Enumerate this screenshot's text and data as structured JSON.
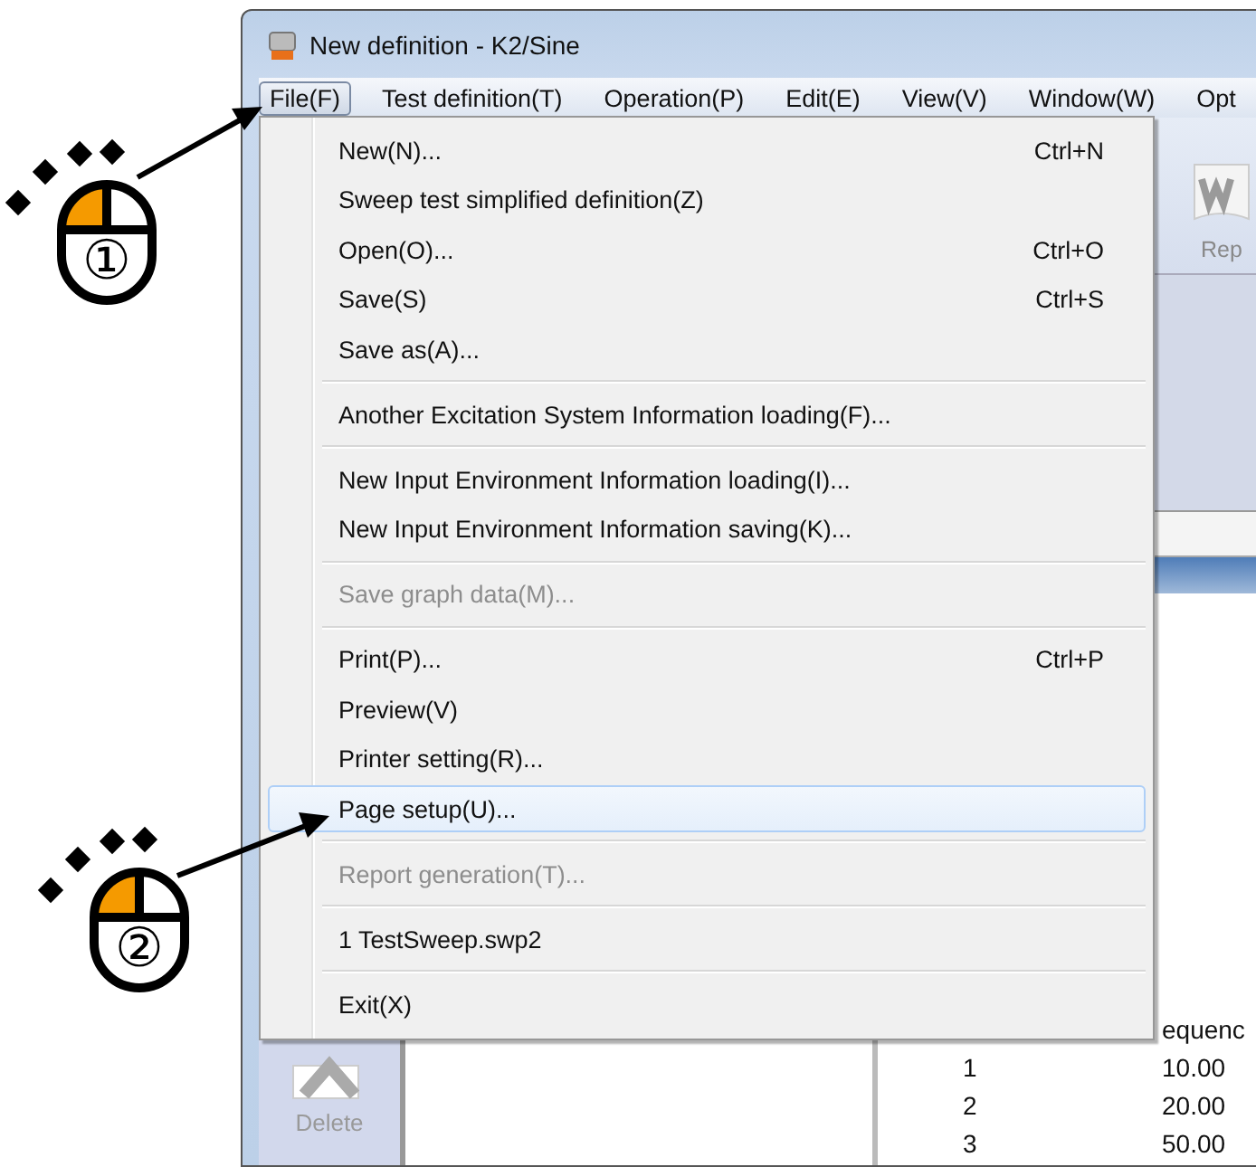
{
  "window": {
    "title": "New definition - K2/Sine"
  },
  "menubar": [
    {
      "label": "File(F)",
      "selected": true
    },
    {
      "label": "Test definition(T)",
      "selected": false
    },
    {
      "label": "Operation(P)",
      "selected": false
    },
    {
      "label": "Edit(E)",
      "selected": false
    },
    {
      "label": "View(V)",
      "selected": false
    },
    {
      "label": "Window(W)",
      "selected": false
    },
    {
      "label": "Opt",
      "selected": false
    }
  ],
  "toolbar": {
    "button_label": "Rep"
  },
  "side_toolbar": {
    "delete_button": {
      "label": "Delete",
      "disabled": true
    }
  },
  "table": {
    "columns": [
      "equenc"
    ],
    "rows": [
      {
        "column_1": "1",
        "column_2": "10.00"
      },
      {
        "column_1": "2",
        "column_2": "20.00"
      },
      {
        "column_1": "3",
        "column_2": "50.00"
      }
    ]
  },
  "file_menu": [
    {
      "kind": "item",
      "label": "New(N)...",
      "shortcut": "Ctrl+N",
      "disabled": false,
      "selected": false
    },
    {
      "kind": "item",
      "label": "Sweep test simplified definition(Z)",
      "disabled": false,
      "selected": false
    },
    {
      "kind": "item",
      "label": "Open(O)...",
      "shortcut": "Ctrl+O",
      "disabled": false,
      "selected": false
    },
    {
      "kind": "item",
      "label": "Save(S)",
      "shortcut": "Ctrl+S",
      "disabled": false,
      "selected": false
    },
    {
      "kind": "item",
      "label": "Save as(A)...",
      "disabled": false,
      "selected": false
    },
    {
      "kind": "separator"
    },
    {
      "kind": "item",
      "label": "Another Excitation System Information loading(F)...",
      "disabled": false,
      "selected": false
    },
    {
      "kind": "separator"
    },
    {
      "kind": "item",
      "label": "New Input Environment Information loading(I)...",
      "disabled": false,
      "selected": false
    },
    {
      "kind": "item",
      "label": "New Input Environment Information saving(K)...",
      "disabled": false,
      "selected": false
    },
    {
      "kind": "separator"
    },
    {
      "kind": "item",
      "label": "Save graph data(M)...",
      "disabled": true,
      "selected": false
    },
    {
      "kind": "separator"
    },
    {
      "kind": "item",
      "label": "Print(P)...",
      "shortcut": "Ctrl+P",
      "disabled": false,
      "selected": false
    },
    {
      "kind": "item",
      "label": "Preview(V)",
      "disabled": false,
      "selected": false
    },
    {
      "kind": "item",
      "label": "Printer setting(R)...",
      "disabled": false,
      "selected": false
    },
    {
      "kind": "item",
      "label": "Page setup(U)...",
      "disabled": false,
      "selected": true
    },
    {
      "kind": "separator"
    },
    {
      "kind": "item",
      "label": "Report generation(T)...",
      "disabled": true,
      "selected": false
    },
    {
      "kind": "separator"
    },
    {
      "kind": "item",
      "label": "1 TestSweep.swp2",
      "disabled": false,
      "selected": false
    },
    {
      "kind": "separator"
    },
    {
      "kind": "item",
      "label": "Exit(X)",
      "disabled": false,
      "selected": false
    }
  ],
  "annotations": [
    {
      "marker": "①"
    },
    {
      "marker": "②"
    }
  ]
}
